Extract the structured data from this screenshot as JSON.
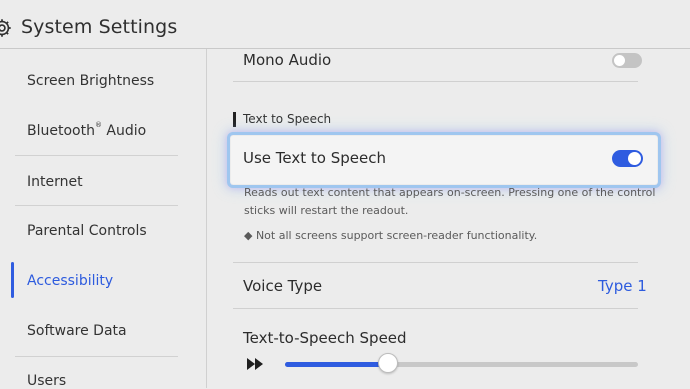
{
  "header": {
    "title": "System Settings",
    "icon": "gear-icon"
  },
  "sidebar": {
    "items": [
      {
        "label": "Screen Brightness"
      },
      {
        "label": "Bluetooth",
        "sup": "®",
        "label_suffix": " Audio"
      },
      {
        "label": "Internet"
      },
      {
        "label": "Parental Controls"
      },
      {
        "label": "Accessibility",
        "active": true
      },
      {
        "label": "Software Data"
      },
      {
        "label": "Users"
      }
    ]
  },
  "content": {
    "mono_audio": {
      "label": "Mono Audio",
      "enabled": false
    },
    "section_title": "Text to Speech",
    "use_tts": {
      "label": "Use Text to Speech",
      "enabled": true
    },
    "description": [
      "Reads out text content that appears on-screen. Pressing one of the control",
      "sticks will restart the readout."
    ],
    "note": "◆ Not all screens support screen-reader functionality.",
    "voice_type": {
      "label": "Voice Type",
      "value": "Type 1"
    },
    "speed": {
      "label": "Text-to-Speech Speed",
      "level": 0.29,
      "icon": "fast-forward-icon"
    }
  },
  "colors": {
    "accent": "#2f5ce0",
    "toggle_off": "#c4c4c4",
    "background": "#ececec"
  }
}
